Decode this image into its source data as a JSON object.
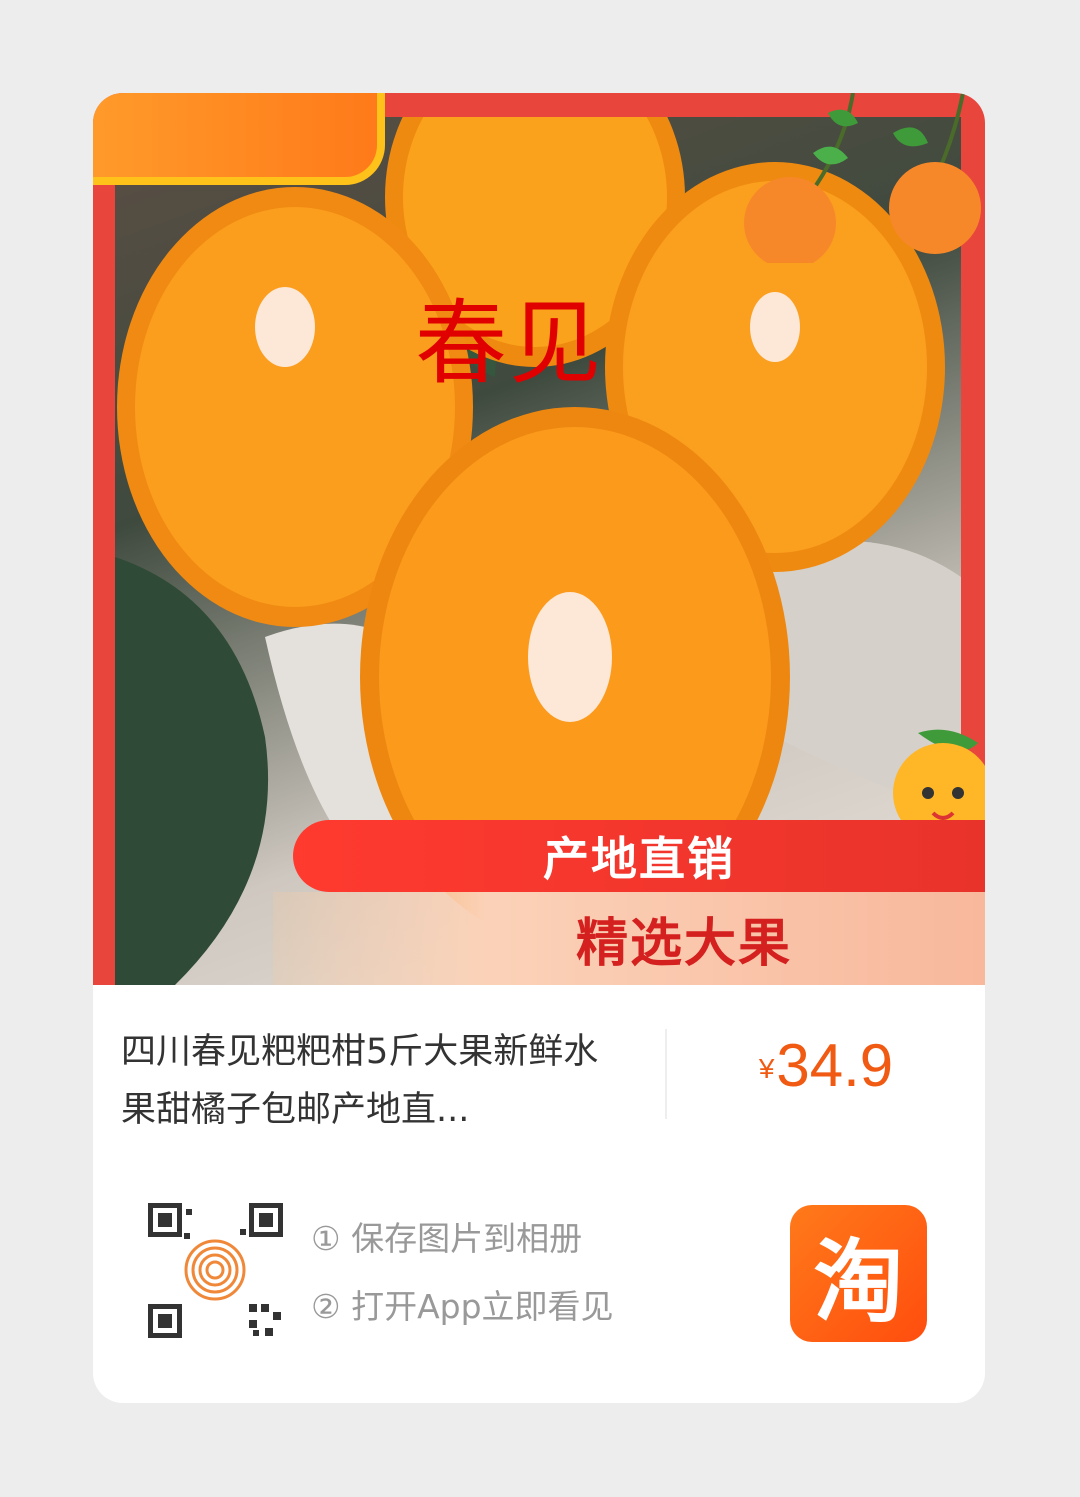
{
  "product": {
    "overlay_text": "春见",
    "banner_line1": "产地直销",
    "banner_line2": "精选大果",
    "title": "四川春见粑粑柑5斤大果新鲜水果甜橘子包邮产地直...",
    "price_symbol": "¥",
    "price": "34.9"
  },
  "instructions": {
    "step1": "① 保存图片到相册",
    "step2": "② 打开App立即看见"
  },
  "app_icon": {
    "glyph": "淘",
    "name": "taobao-icon"
  },
  "colors": {
    "accent": "#f05a12",
    "frame": "#e8453c",
    "banner_red": "#e8332b"
  }
}
